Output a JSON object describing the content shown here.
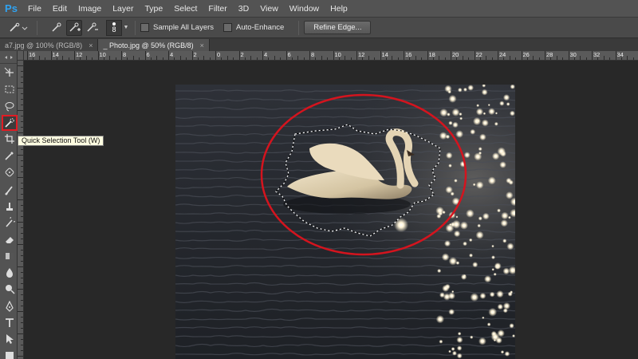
{
  "app": {
    "logo": "Ps"
  },
  "menu": [
    "File",
    "Edit",
    "Image",
    "Layer",
    "Type",
    "Select",
    "Filter",
    "3D",
    "View",
    "Window",
    "Help"
  ],
  "options": {
    "brush_size": "8",
    "sample_all_layers": "Sample All Layers",
    "auto_enhance": "Auto-Enhance",
    "refine_edge": "Refine Edge..."
  },
  "tabs": [
    {
      "label": "a7.jpg @ 100% (RGB/8)",
      "close": "×"
    },
    {
      "label": "_ Photo.jpg @ 50% (RGB/8)",
      "close": "×"
    }
  ],
  "ruler_numbers": [
    "16",
    "14",
    "12",
    "10",
    "8",
    "6",
    "4",
    "2",
    "0",
    "2",
    "4",
    "6",
    "8",
    "10",
    "12",
    "14",
    "16",
    "18",
    "20",
    "22",
    "24",
    "26",
    "28",
    "30",
    "32",
    "34"
  ],
  "tooltip": "Quick Selection Tool (W)",
  "tools": [
    "move-tool-icon",
    "marquee-tool-icon",
    "lasso-tool-icon",
    "quick-selection-tool-icon",
    "crop-tool-icon",
    "eyedropper-tool-icon",
    "healing-brush-icon",
    "brush-tool-icon",
    "clone-stamp-icon",
    "history-brush-icon",
    "eraser-tool-icon",
    "gradient-tool-icon",
    "blur-tool-icon",
    "dodge-tool-icon",
    "pen-tool-icon",
    "type-tool-icon",
    "path-selection-icon",
    "rectangle-tool-icon"
  ],
  "colors": {
    "selection_ellipse": "#d4141e",
    "tool_highlight": "#e21b23",
    "ps_blue": "#2fa3f2"
  }
}
